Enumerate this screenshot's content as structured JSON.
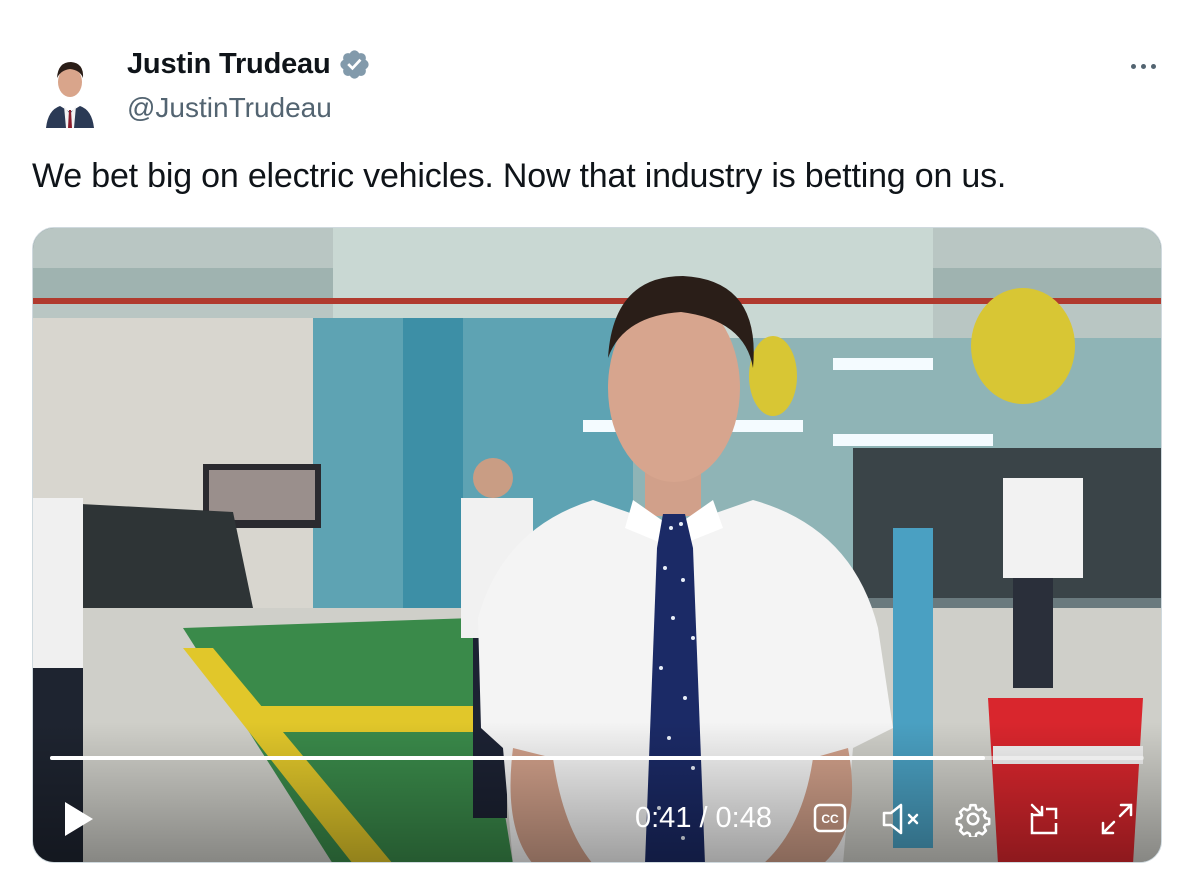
{
  "author": {
    "display_name": "Justin Trudeau",
    "handle": "@JustinTrudeau",
    "verified": true
  },
  "tweet": {
    "text": "We bet big on electric vehicles. Now that industry is betting on us."
  },
  "video": {
    "current_time": "0:41",
    "separator": "/",
    "duration": "0:48",
    "progress": 0.855,
    "controls": [
      "play-icon",
      "captions-icon",
      "mute-icon",
      "settings-icon",
      "picture-in-picture-icon",
      "fullscreen-icon"
    ]
  },
  "colors": {
    "verified": "#829aab",
    "text_primary": "#0f1419",
    "text_secondary": "#536471",
    "border": "#cfd9de"
  }
}
